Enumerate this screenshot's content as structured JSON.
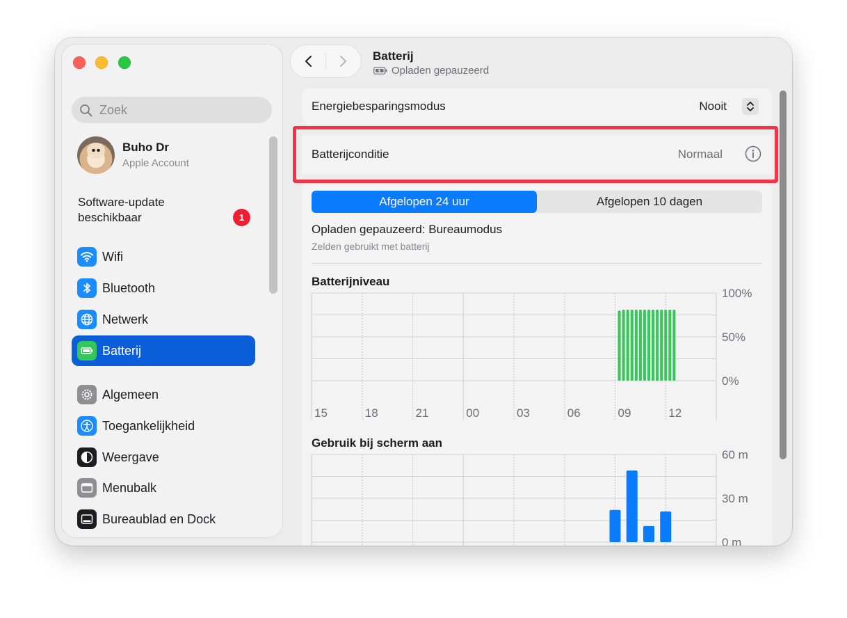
{
  "sidebar": {
    "search_placeholder": "Zoek",
    "account": {
      "name": "Buho Dr",
      "subtitle": "Apple Account"
    },
    "update": {
      "label": "Software-update\nbeschikbaar",
      "badge": "1"
    },
    "items": [
      {
        "label": "Wifi",
        "icon": "wifi-icon",
        "color": "#1a8cfe"
      },
      {
        "label": "Bluetooth",
        "icon": "bluetooth-icon",
        "color": "#1a8cfe"
      },
      {
        "label": "Netwerk",
        "icon": "globe-icon",
        "color": "#1a8cfe"
      },
      {
        "label": "Batterij",
        "icon": "battery-icon",
        "color": "#34c759",
        "selected": true
      },
      {
        "label": "Algemeen",
        "icon": "gear-icon",
        "color": "#8e8e93"
      },
      {
        "label": "Toegankelijkheid",
        "icon": "accessibility-icon",
        "color": "#1a8cfe"
      },
      {
        "label": "Weergave",
        "icon": "appearance-icon",
        "color": "#1d1d1f"
      },
      {
        "label": "Menubalk",
        "icon": "menubar-icon",
        "color": "#8e8e93"
      },
      {
        "label": "Bureaublad en Dock",
        "icon": "dock-icon",
        "color": "#1d1d1f"
      }
    ]
  },
  "header": {
    "title": "Batterij",
    "subtitle": "Opladen gepauzeerd"
  },
  "energy": {
    "label": "Energiebesparingsmodus",
    "value": "Nooit"
  },
  "condition": {
    "label": "Batterijconditie",
    "value": "Normaal"
  },
  "history": {
    "tabs": [
      "Afgelopen 24 uur",
      "Afgelopen 10 dagen"
    ],
    "active_tab": 0,
    "status": "Opladen gepauzeerd: Bureaumodus",
    "status_sub": "Zelden gebruikt met batterij"
  },
  "chart_data": [
    {
      "type": "bar",
      "title": "Batterijniveau",
      "x_ticks": [
        "15",
        "18",
        "21",
        "00",
        "03",
        "06",
        "09",
        "12"
      ],
      "y_ticks": [
        "100%",
        "50%",
        "0%"
      ],
      "ylim": [
        0,
        100
      ],
      "bars": [
        {
          "x": 9.25,
          "y": 80
        },
        {
          "x": 9.5,
          "y": 81
        },
        {
          "x": 9.75,
          "y": 81
        },
        {
          "x": 10.0,
          "y": 81
        },
        {
          "x": 10.25,
          "y": 81
        },
        {
          "x": 10.5,
          "y": 81
        },
        {
          "x": 10.75,
          "y": 81
        },
        {
          "x": 11.0,
          "y": 81
        },
        {
          "x": 11.25,
          "y": 81
        },
        {
          "x": 11.5,
          "y": 81
        },
        {
          "x": 11.75,
          "y": 81
        },
        {
          "x": 12.0,
          "y": 81
        },
        {
          "x": 12.25,
          "y": 81
        },
        {
          "x": 12.5,
          "y": 81
        }
      ],
      "color": "#34c759"
    },
    {
      "type": "bar",
      "title": "Gebruik bij scherm aan",
      "y_ticks": [
        "60 m",
        "30 m",
        "0 m"
      ],
      "ylim": [
        0,
        60
      ],
      "bars": [
        {
          "x": 9.0,
          "y": 22
        },
        {
          "x": 10.0,
          "y": 49
        },
        {
          "x": 11.0,
          "y": 11
        },
        {
          "x": 12.0,
          "y": 21
        }
      ],
      "color": "#0b7bfe"
    }
  ]
}
